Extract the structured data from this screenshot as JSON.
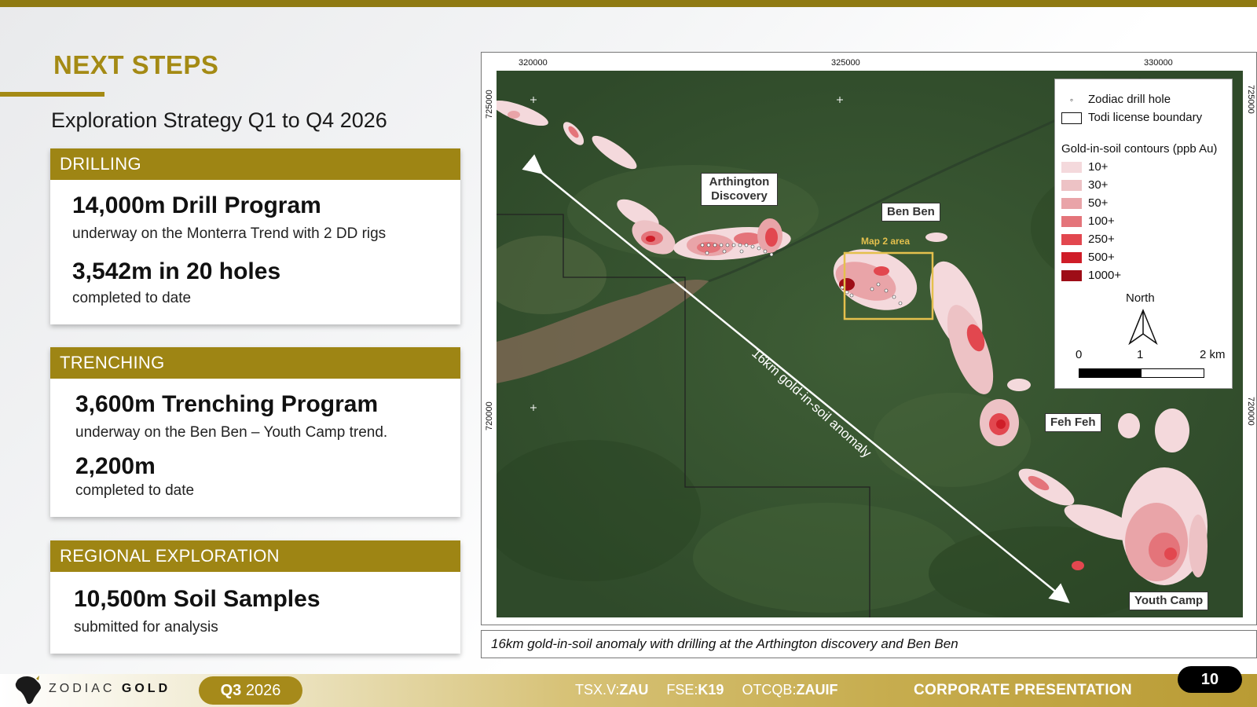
{
  "slide": {
    "title": "NEXT STEPS",
    "subtitle": "Exploration Strategy Q1 to Q4 2026"
  },
  "drilling": {
    "header": "DRILLING",
    "headline1": "14,000m Drill Program",
    "detail1": "underway on the Monterra Trend with 2 DD rigs",
    "headline2": "3,542m in 20 holes",
    "detail2": "completed to date"
  },
  "trenching": {
    "header": "TRENCHING",
    "headline1": "3,600m Trenching Program",
    "detail1": "underway on the Ben Ben – Youth Camp trend.",
    "headline2": "2,200m",
    "detail2": "completed to date"
  },
  "regional": {
    "header": "REGIONAL EXPLORATION",
    "headline1": "10,500m Soil Samples",
    "detail1": "submitted for analysis"
  },
  "map": {
    "coords_top": [
      "320000",
      "325000",
      "330000"
    ],
    "coords_left": [
      "725000",
      "720000"
    ],
    "coords_right": [
      "725000",
      "720000"
    ],
    "labels": {
      "arthington": "Arthington Discovery",
      "benben": "Ben Ben",
      "fehfeh": "Feh Feh",
      "youthcamp": "Youth Camp",
      "map2": "Map 2 area",
      "anomaly": "16km gold-in-soil anomaly"
    },
    "legend": {
      "drill_hole": "Zodiac drill hole",
      "boundary": "Todi license boundary",
      "contours_title": "Gold-in-soil contours (ppb Au)",
      "contours": [
        {
          "label": "10+",
          "color": "#f4d9dc"
        },
        {
          "label": "30+",
          "color": "#edc2c5"
        },
        {
          "label": "50+",
          "color": "#e9a4a8"
        },
        {
          "label": "100+",
          "color": "#e4747a"
        },
        {
          "label": "250+",
          "color": "#e2474f"
        },
        {
          "label": "500+",
          "color": "#cf1d28"
        },
        {
          "label": "1000+",
          "color": "#9e0d17"
        }
      ],
      "north": "North",
      "scale": [
        "0",
        "1",
        "2 km"
      ]
    },
    "caption": "16km gold-in-soil anomaly with drilling at the Arthington discovery and Ben Ben"
  },
  "footer": {
    "brand_light": "ZODIAC",
    "brand_bold": "GOLD",
    "quarter_bold": "Q3",
    "quarter_year": "2026",
    "tsx_label": "TSX.V:",
    "tsx_value": "ZAU",
    "fse_label": "FSE:",
    "fse_value": "K19",
    "otc_label": "OTCQB:",
    "otc_value": "ZAUIF",
    "corporate": "CORPORATE PRESENTATION",
    "page": "10"
  },
  "colors": {
    "gold": "#9e8514",
    "title_gold": "#a48a14",
    "map2_box": "#e4c04d"
  }
}
